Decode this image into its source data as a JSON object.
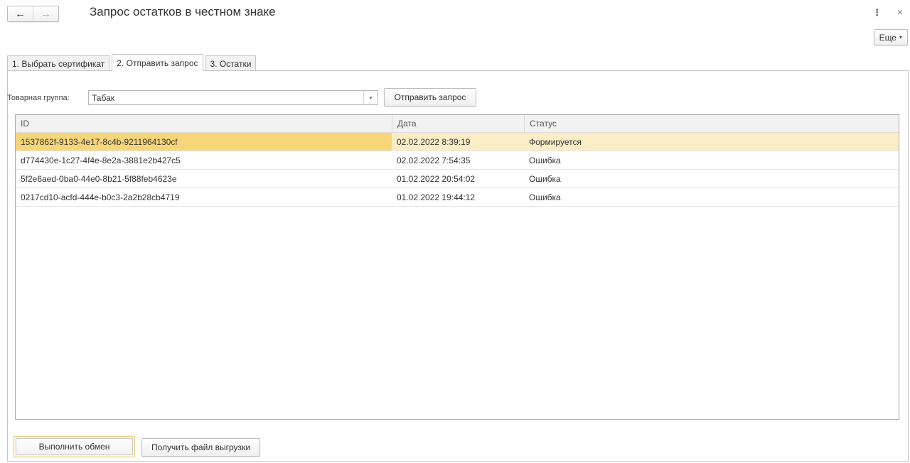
{
  "window": {
    "title": "Запрос остатков в честном знаке",
    "back_icon": "←",
    "forward_icon": "→",
    "menu_icon": "⋮",
    "close_icon": "×"
  },
  "toolbar": {
    "more_label": "Еще",
    "more_caret": "▾"
  },
  "tabs": [
    {
      "label": "1. Выбрать сертификат",
      "active": false
    },
    {
      "label": "2. Отправить запрос",
      "active": true
    },
    {
      "label": "3. Остатки",
      "active": false
    }
  ],
  "form": {
    "group_label": "Товарная группа:",
    "group_value": "Табак",
    "dropdown_caret": "▾",
    "send_label": "Отправить запрос"
  },
  "table": {
    "columns": [
      "ID",
      "Дата",
      "Статус"
    ],
    "rows": [
      {
        "id": "1537862f-9133-4e17-8c4b-9211964130cf",
        "date": "02.02.2022 8:39:19",
        "status": "Формируется"
      },
      {
        "id": "d774430e-1c27-4f4e-8e2a-3881e2b427c5",
        "date": "02.02.2022 7:54:35",
        "status": "Ошибка"
      },
      {
        "id": "5f2e6aed-0ba0-44e0-8b21-5f88feb4623e",
        "date": "01.02.2022 20:54:02",
        "status": "Ошибка"
      },
      {
        "id": "0217cd10-acfd-444e-b0c3-2a2b28cb4719",
        "date": "01.02.2022 19:44:12",
        "status": "Ошибка"
      }
    ]
  },
  "footer": {
    "exchange_label": "Выполнить обмен",
    "download_label": "Получить файл выгрузки"
  },
  "colors": {
    "selected_row": "#fbeec7",
    "selected_cell": "#f7d67a",
    "default_button_border": "#e6c878"
  }
}
